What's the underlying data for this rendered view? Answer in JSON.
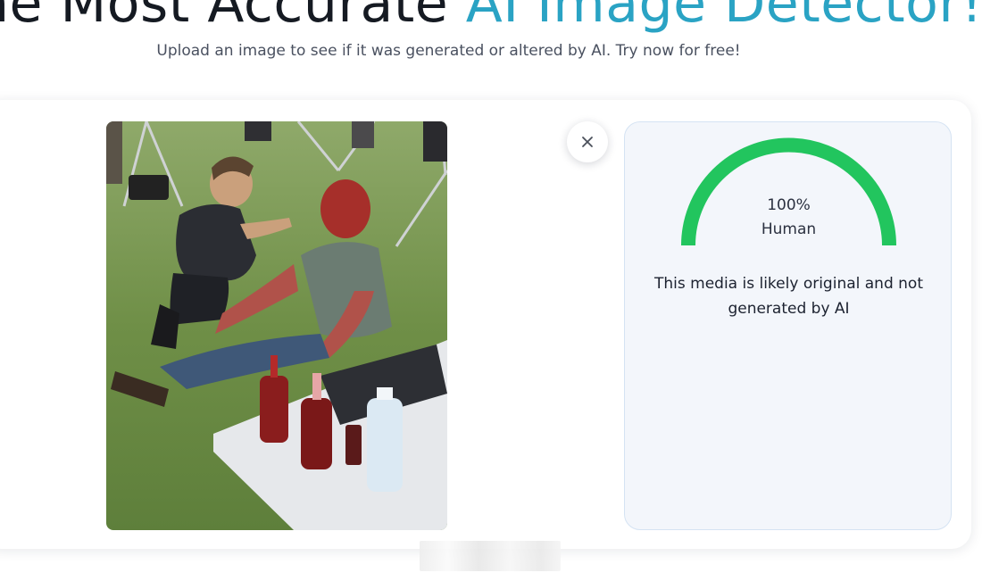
{
  "hero": {
    "title_prefix": "he Most Accurate",
    "title_accent": "AI Image Detector!"
  },
  "subtitle": "Upload an image to see if it was generated or altered by AI. Try now for free!",
  "upload": {
    "close_icon": "close-icon"
  },
  "result": {
    "percent": "100%",
    "label": "Human",
    "score": 1.0,
    "gauge_color": "#22c55e",
    "verdict": "This media is likely original and not generated by AI"
  },
  "colors": {
    "accent": "#2aa3c4",
    "panel_bg": "#f3f6fb",
    "panel_border": "#d5e3f3"
  }
}
